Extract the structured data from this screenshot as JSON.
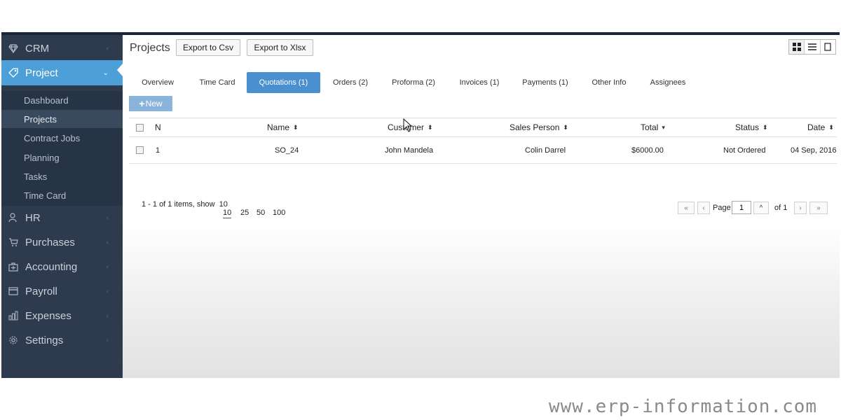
{
  "sidebar": {
    "modules": [
      {
        "label": "CRM",
        "icon": "diamond-icon"
      },
      {
        "label": "Project",
        "icon": "tag-icon"
      },
      {
        "label": "HR",
        "icon": "people-icon"
      },
      {
        "label": "Purchases",
        "icon": "cart-icon"
      },
      {
        "label": "Accounting",
        "icon": "briefcase-icon"
      },
      {
        "label": "Payroll",
        "icon": "card-icon"
      },
      {
        "label": "Expenses",
        "icon": "bar-chart-icon"
      },
      {
        "label": "Settings",
        "icon": "gear-icon"
      }
    ],
    "project_sub": [
      "Dashboard",
      "Projects",
      "Contract Jobs",
      "Planning",
      "Tasks",
      "Time Card"
    ]
  },
  "header": {
    "title": "Projects",
    "export_csv": "Export to Csv",
    "export_xlsx": "Export to Xlsx"
  },
  "tabs": [
    "Overview",
    "Time Card",
    "Quotations (1)",
    "Orders (2)",
    "Proforma (2)",
    "Invoices (1)",
    "Payments (1)",
    "Other Info",
    "Assignees"
  ],
  "new_button": "New",
  "table": {
    "columns": [
      "N",
      "Name",
      "Customer",
      "Sales Person",
      "Total",
      "Status",
      "Date"
    ],
    "rows": [
      {
        "n": "1",
        "name": "SO_24",
        "customer": "John Mandela",
        "sales_person": "Colin Darrel",
        "total": "$6000.00",
        "status": "Not Ordered",
        "date": "04 Sep, 2016"
      }
    ]
  },
  "pager": {
    "summary": "1 - 1 of 1 items, show",
    "show_current": "10",
    "sizes": [
      "10",
      "25",
      "50",
      "100"
    ],
    "page_label": "Page",
    "page_value": "1",
    "of_label": "of 1"
  },
  "watermark": "www.erp-information.com",
  "colors": {
    "sidebar_bg": "#2e3b4e",
    "accent": "#4da0d7",
    "active_tab": "#4a90cf",
    "new_button": "#8ab4dc"
  }
}
